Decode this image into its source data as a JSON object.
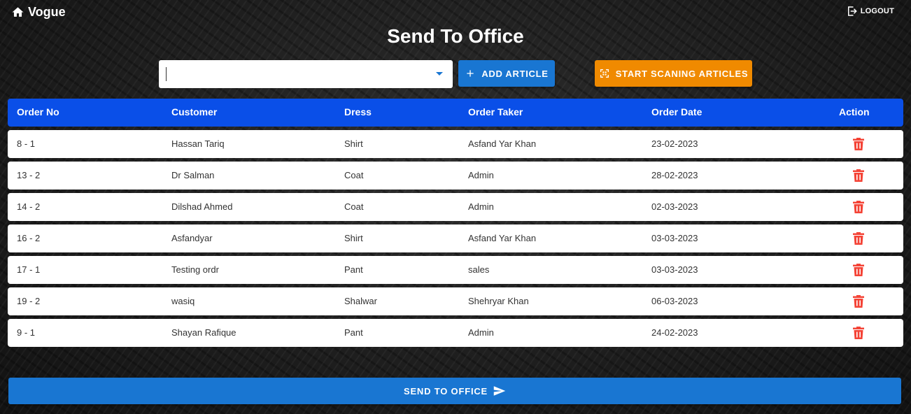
{
  "header": {
    "brand": "Vogue",
    "logout_label": "LOGOUT"
  },
  "page": {
    "title": "Send To Office"
  },
  "article_select": {
    "value": ""
  },
  "buttons": {
    "add_article": "ADD ARTICLE",
    "start_scanning": "START SCANING ARTICLES",
    "send_to_office": "SEND TO OFFICE"
  },
  "table": {
    "columns": [
      "Order No",
      "Customer",
      "Dress",
      "Order Taker",
      "Order Date",
      "Action"
    ],
    "rows": [
      [
        "8 - 1",
        "Hassan Tariq",
        "Shirt",
        "Asfand Yar Khan",
        "23-02-2023"
      ],
      [
        "13 - 2",
        "Dr Salman",
        "Coat",
        "Admin",
        "28-02-2023"
      ],
      [
        "14 - 2",
        "Dilshad Ahmed",
        "Coat",
        "Admin",
        "02-03-2023"
      ],
      [
        "16 - 2",
        "Asfandyar",
        "Shirt",
        "Asfand Yar Khan",
        "03-03-2023"
      ],
      [
        "17 - 1",
        "Testing ordr",
        "Pant",
        "sales",
        "03-03-2023"
      ],
      [
        "19 - 2",
        "wasiq",
        "Shalwar",
        "Shehryar Khan",
        "06-03-2023"
      ],
      [
        "9 - 1",
        "Shayan Rafique",
        "Pant",
        "Admin",
        "24-02-2023"
      ]
    ]
  },
  "colors": {
    "primary": "#1976d2",
    "header_blue": "#0a4fe8",
    "scan_orange": "#f08a00",
    "delete_red": "#f44336"
  },
  "icons": {
    "brand": "home-icon",
    "logout": "logout-icon",
    "add": "plus-icon",
    "scan": "scan-icon",
    "delete": "trash-icon",
    "send": "send-icon"
  }
}
